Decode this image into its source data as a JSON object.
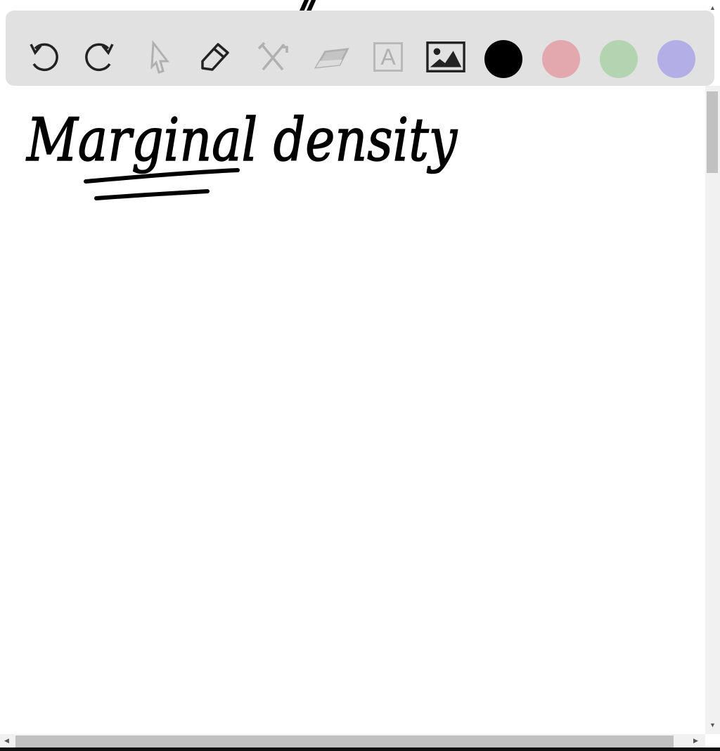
{
  "toolbar": {
    "tools": [
      {
        "name": "undo-icon",
        "enabled": true
      },
      {
        "name": "redo-icon",
        "enabled": true
      },
      {
        "name": "select-pointer-icon",
        "enabled": false
      },
      {
        "name": "pen-icon",
        "enabled": true
      },
      {
        "name": "tools-icon",
        "enabled": false
      },
      {
        "name": "eraser-icon",
        "enabled": false
      },
      {
        "name": "text-icon",
        "enabled": false
      },
      {
        "name": "image-icon",
        "enabled": true
      }
    ],
    "text_icon_letter": "A",
    "colors": [
      "#000000",
      "#e3a8ad",
      "#b3d4b0",
      "#b3aee6"
    ]
  },
  "canvas": {
    "handwriting": "Marginal density",
    "ink_color": "#000000"
  }
}
